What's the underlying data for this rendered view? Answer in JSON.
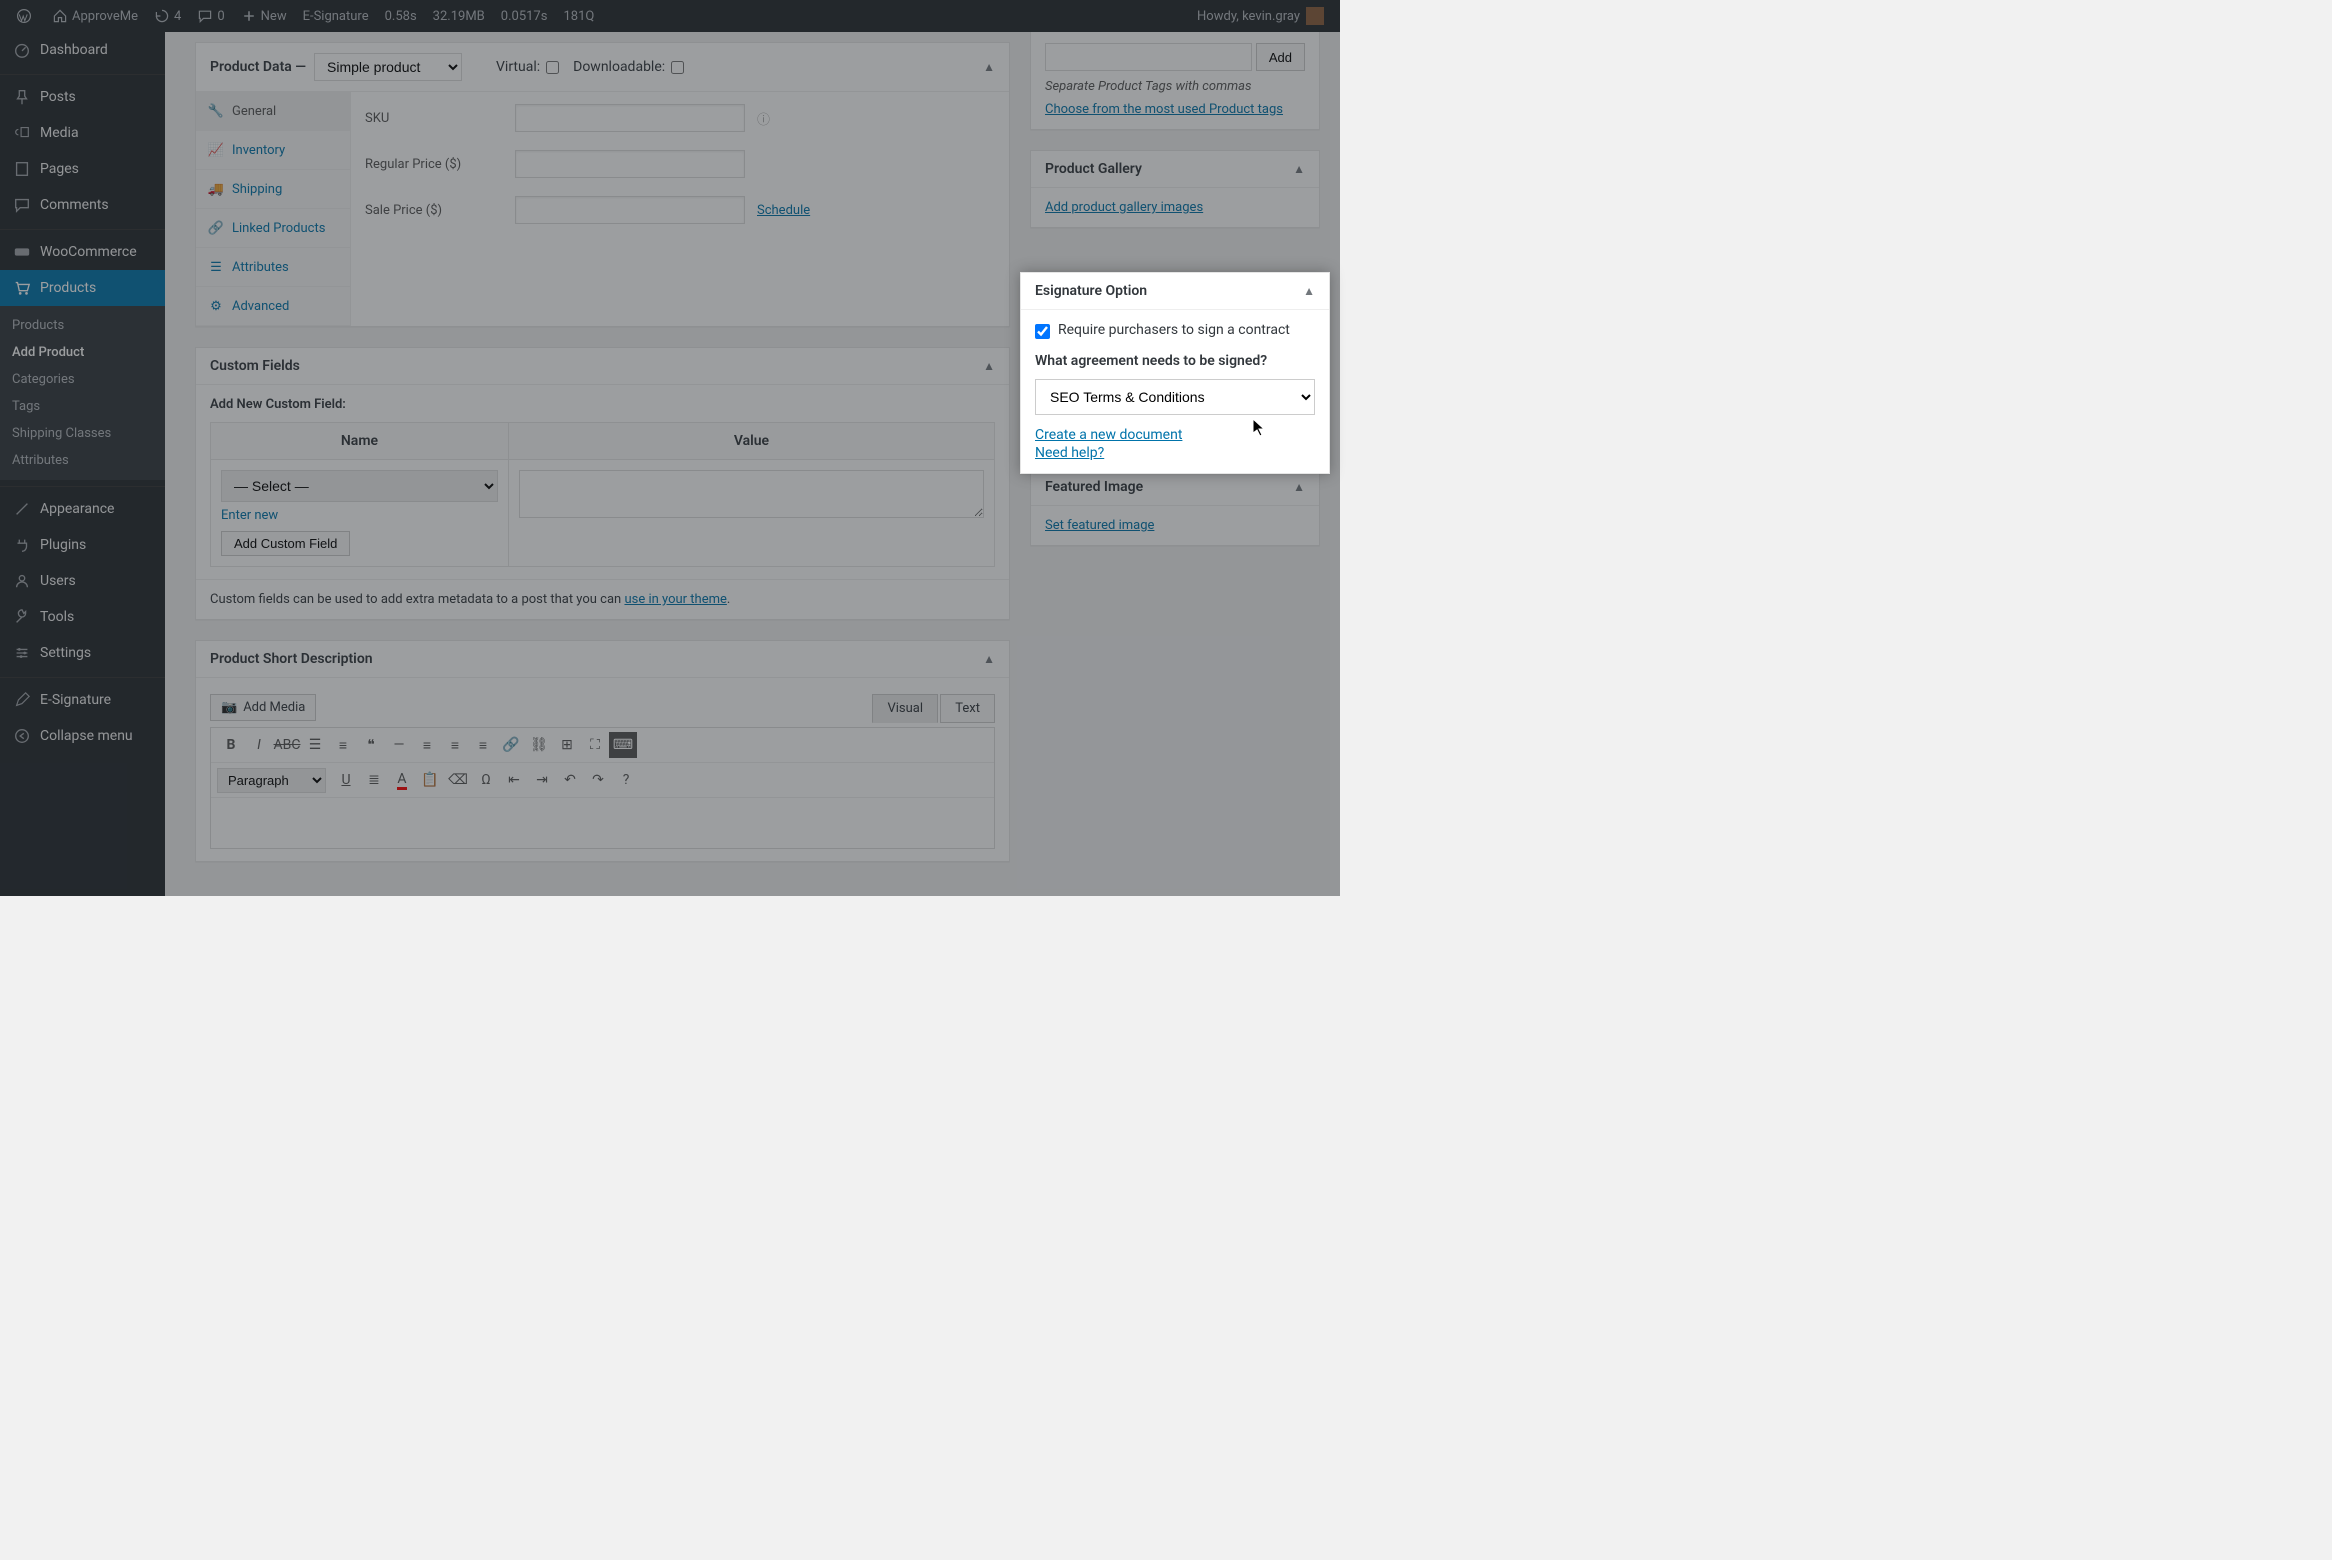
{
  "topbar": {
    "site_name": "ApproveMe",
    "updates": "4",
    "comments": "0",
    "new_label": "New",
    "menuitems": [
      "E-Signature",
      "0.58s",
      "32.19MB",
      "0.0517s",
      "181Q"
    ],
    "howdy": "Howdy, kevin.gray"
  },
  "sidebar": {
    "items": [
      {
        "label": "Dashboard",
        "icon": "dashboard-icon"
      },
      {
        "label": "Posts",
        "icon": "pin-icon"
      },
      {
        "label": "Media",
        "icon": "media-icon"
      },
      {
        "label": "Pages",
        "icon": "page-icon"
      },
      {
        "label": "Comments",
        "icon": "comment-icon"
      },
      {
        "label": "WooCommerce",
        "icon": "woo-icon"
      },
      {
        "label": "Products",
        "icon": "cart-icon",
        "active": true
      },
      {
        "label": "Appearance",
        "icon": "brush-icon"
      },
      {
        "label": "Plugins",
        "icon": "plug-icon"
      },
      {
        "label": "Users",
        "icon": "user-icon"
      },
      {
        "label": "Tools",
        "icon": "wrench-icon"
      },
      {
        "label": "Settings",
        "icon": "sliders-icon"
      },
      {
        "label": "E-Signature",
        "icon": "pencil-icon"
      },
      {
        "label": "Collapse menu",
        "icon": "collapse-icon"
      }
    ],
    "submenu": [
      "Products",
      "Add Product",
      "Categories",
      "Tags",
      "Shipping Classes",
      "Attributes"
    ],
    "submenu_current": "Add Product"
  },
  "product_data": {
    "header": "Product Data —",
    "type": "Simple product",
    "virtual_label": "Virtual:",
    "downloadable_label": "Downloadable:",
    "tabs": [
      "General",
      "Inventory",
      "Shipping",
      "Linked Products",
      "Attributes",
      "Advanced"
    ],
    "fields": {
      "sku_label": "SKU",
      "sku_value": "",
      "regular_label": "Regular Price ($)",
      "regular_value": "",
      "sale_label": "Sale Price ($)",
      "sale_value": "",
      "schedule_link": "Schedule"
    }
  },
  "custom_fields": {
    "title": "Custom Fields",
    "add_label": "Add New Custom Field:",
    "name_header": "Name",
    "value_header": "Value",
    "select_placeholder": "— Select —",
    "enter_new": "Enter new",
    "add_button": "Add Custom Field",
    "hint_prefix": "Custom fields can be used to add extra metadata to a post that you can ",
    "hint_link": "use in your theme",
    "hint_suffix": "."
  },
  "short_desc": {
    "title": "Product Short Description",
    "add_media": "Add Media",
    "visual": "Visual",
    "text": "Text",
    "paragraph": "Paragraph"
  },
  "tags_box": {
    "add_button": "Add",
    "hint": "Separate Product Tags with commas",
    "popular_link": "Choose from the most used Product tags"
  },
  "gallery_box": {
    "title": "Product Gallery",
    "link": "Add product gallery images"
  },
  "esig_box": {
    "title": "Esignature Option",
    "require_label": "Require purchasers to sign a contract",
    "question": "What agreement needs to be signed?",
    "selected": "SEO Terms & Conditions",
    "create_link": "Create a new document",
    "help_link": "Need help?"
  },
  "featured_box": {
    "title": "Featured Image",
    "link": "Set featured image"
  }
}
